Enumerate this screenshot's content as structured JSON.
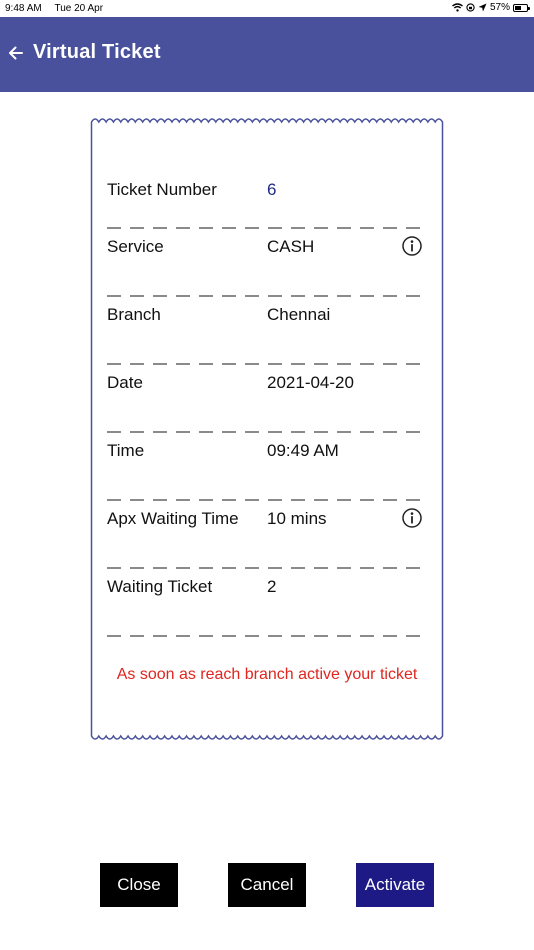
{
  "status_bar": {
    "time": "9:48 AM",
    "date": "Tue 20 Apr",
    "battery": "57%",
    "battery_level": 0.57
  },
  "app_bar": {
    "title": "Virtual Ticket",
    "back_icon": "arrow-left-icon"
  },
  "ticket": {
    "rows": [
      {
        "label": "Ticket Number",
        "value": "6"
      },
      {
        "label": "Service",
        "value": "CASH"
      },
      {
        "label": "Branch",
        "value": "Chennai"
      },
      {
        "label": "Date",
        "value": "2021-04-20"
      },
      {
        "label": "Time",
        "value": "09:49 AM"
      },
      {
        "label": "Apx Waiting Time",
        "value": "10 mins"
      },
      {
        "label": "Waiting Ticket",
        "value": "2"
      }
    ],
    "notice": "As soon as reach branch active your ticket"
  },
  "buttons": {
    "close": "Close",
    "cancel": "Cancel",
    "activate": "Activate"
  },
  "colors": {
    "app_bar": "#4a519c",
    "ticket_border": "#4a519c",
    "notice": "#e0261f",
    "activate": "#1d1a86",
    "ticket_number": "#1f2a8c"
  }
}
